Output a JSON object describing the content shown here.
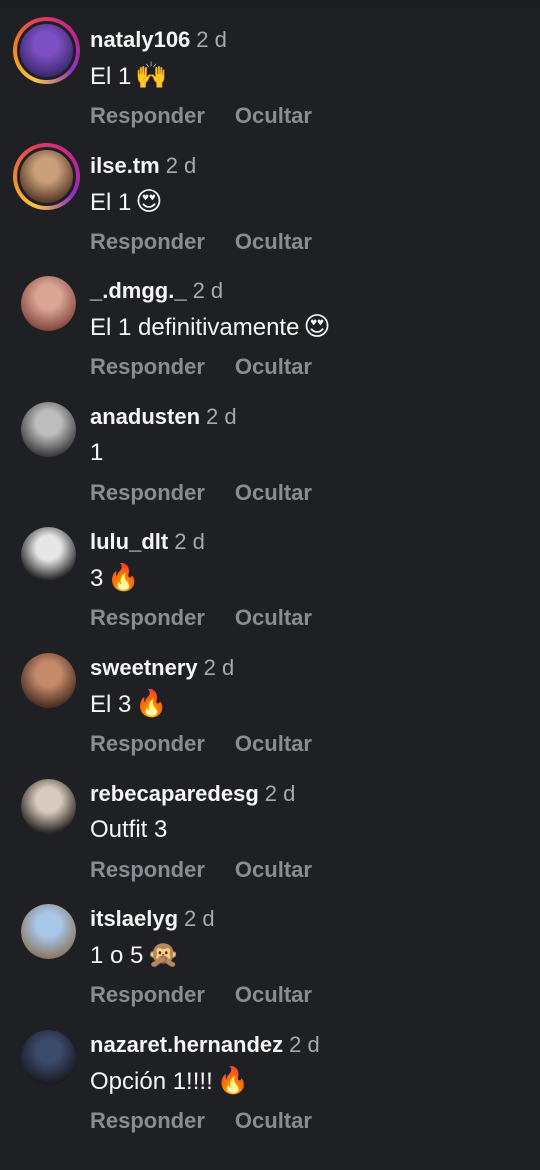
{
  "comments": [
    {
      "username": "nataly106",
      "time": "2 d",
      "text": "El 1",
      "emoji": "🙌",
      "has_story_ring": true,
      "avatar_colors": [
        "#7d4fc4",
        "#3d2a6e"
      ]
    },
    {
      "username": "ilse.tm",
      "time": "2 d",
      "text": "El 1",
      "emoji": "😍",
      "has_story_ring": true,
      "avatar_colors": [
        "#c9a07a",
        "#5a3b2a"
      ]
    },
    {
      "username": "_.dmgg._",
      "time": "2 d",
      "text": "El 1 definitivamente",
      "emoji": "😍",
      "has_story_ring": false,
      "avatar_colors": [
        "#d9a594",
        "#8a4a44"
      ]
    },
    {
      "username": "anadusten",
      "time": "2 d",
      "text": "1",
      "emoji": "",
      "has_story_ring": false,
      "avatar_colors": [
        "#bdbdbd",
        "#3e3e3e"
      ]
    },
    {
      "username": "lulu_dlt",
      "time": "2 d",
      "text": "3",
      "emoji": "🔥",
      "has_story_ring": false,
      "avatar_colors": [
        "#e6e6e6",
        "#1e1e1e"
      ]
    },
    {
      "username": "sweetnery",
      "time": "2 d",
      "text": "El 3",
      "emoji": "🔥",
      "has_story_ring": false,
      "avatar_colors": [
        "#c58a6a",
        "#4a3024"
      ]
    },
    {
      "username": "rebecaparedesg",
      "time": "2 d",
      "text": "Outfit 3",
      "emoji": "",
      "has_story_ring": false,
      "avatar_colors": [
        "#d8cbbd",
        "#2b2622"
      ]
    },
    {
      "username": "itslaelyg",
      "time": "2 d",
      "text": "1 o 5",
      "emoji": "🙊",
      "has_story_ring": false,
      "avatar_colors": [
        "#a8c6e8",
        "#8a7a66"
      ]
    },
    {
      "username": "nazaret.hernandez",
      "time": "2 d",
      "text": "Opción 1!!!!",
      "emoji": "🔥",
      "has_story_ring": false,
      "avatar_colors": [
        "#3a4a6a",
        "#1a1a24"
      ]
    }
  ],
  "actions": {
    "reply_label": "Responder",
    "hide_label": "Ocultar"
  }
}
